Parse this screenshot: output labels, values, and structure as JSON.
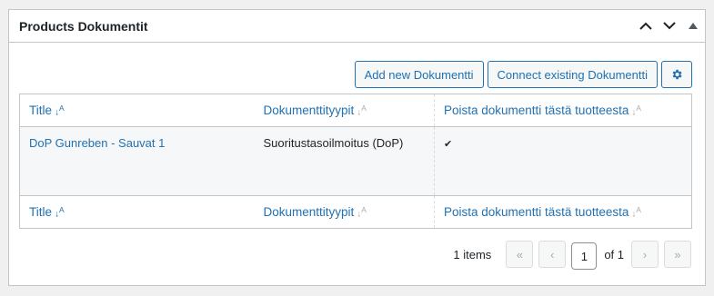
{
  "metabox": {
    "title": "Products Dokumentit",
    "icons": [
      "chevron-up-icon",
      "chevron-down-icon",
      "triangle-up-icon"
    ]
  },
  "toolbar": {
    "add_label": "Add new Dokumentti",
    "connect_label": "Connect existing Dokumentti",
    "settings_icon": "gear-icon"
  },
  "table": {
    "columns": [
      "Title",
      "Dokumenttityypit",
      "Poista dokumentti tästä tuotteesta"
    ],
    "rows": [
      {
        "title": "DoP Gunreben - Sauvat 1",
        "type": "Suoritustasoilmoitus (DoP)",
        "remove": "✔"
      }
    ]
  },
  "pagination": {
    "items_text": "1 items",
    "first": "«",
    "prev": "‹",
    "current_page": "1",
    "of_total": "of 1",
    "next": "›",
    "last": "»"
  },
  "colors": {
    "link": "#2271b1",
    "border": "#c3c4c7",
    "background": "#f0f0f1"
  }
}
